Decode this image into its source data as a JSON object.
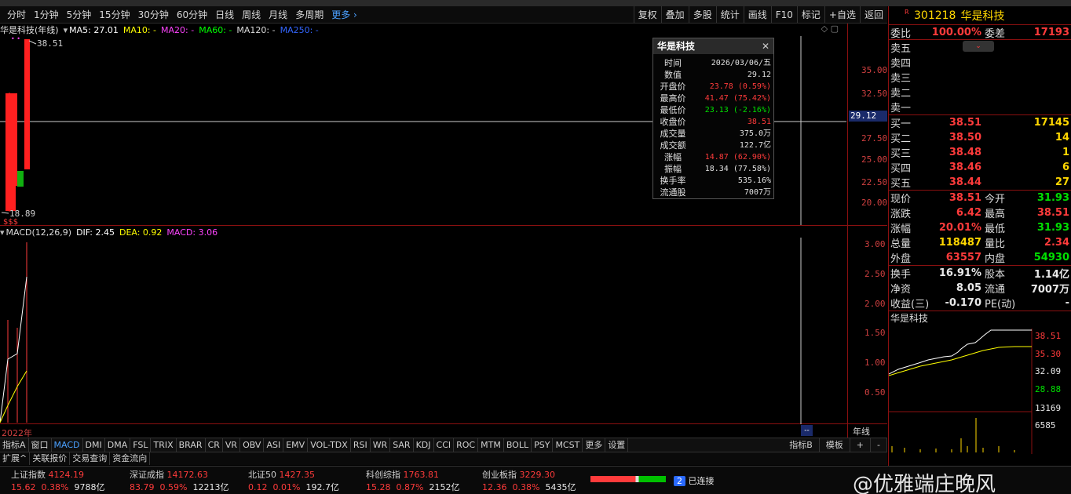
{
  "toolbar": {
    "periods": [
      "分时",
      "1分钟",
      "5分钟",
      "15分钟",
      "30分钟",
      "60分钟",
      "日线",
      "周线",
      "月线",
      "多周期"
    ],
    "more": "更多",
    "right_buttons": [
      "复权",
      "叠加",
      "多股",
      "统计",
      "画线",
      "F10",
      "标记",
      "+自选",
      "返回"
    ]
  },
  "chart": {
    "title": "华是科技(年线)",
    "ma5": "MA5: 27.01",
    "ma10": "MA10: -",
    "ma20": "MA20: -",
    "ma60": "MA60: -",
    "ma120": "MA120: -",
    "ma250": "MA250: -",
    "high_mark": "38.51",
    "low_mark": "18.89",
    "price_ticks": [
      "35.00",
      "32.50",
      "29.12",
      "27.50",
      "25.00",
      "22.50",
      "20.00"
    ],
    "current_price": "29.12",
    "macd_label": "MACD(12,26,9)",
    "dif": "DIF: 2.45",
    "dea": "DEA: 0.92",
    "macd": "MACD: 3.06",
    "macd_ticks": [
      "3.00",
      "2.50",
      "2.00",
      "1.50",
      "1.00",
      "0.50"
    ],
    "x_label": "2022年",
    "period_label": "年线"
  },
  "tooltip": {
    "title": "华是科技",
    "rows": [
      {
        "label": "时间",
        "value": "2026/03/06/五",
        "color": "#e0e0e0"
      },
      {
        "label": "数值",
        "value": "29.12",
        "color": "#e0e0e0"
      },
      {
        "label": "开盘价",
        "value": "23.78 (0.59%)",
        "color": "#ff3b3b"
      },
      {
        "label": "最高价",
        "value": "41.47 (75.42%)",
        "color": "#ff3b3b"
      },
      {
        "label": "最低价",
        "value": "23.13 (-2.16%)",
        "color": "#00e000"
      },
      {
        "label": "收盘价",
        "value": "38.51",
        "color": "#ff3b3b"
      },
      {
        "label": "成交量",
        "value": "375.0万",
        "color": "#e0e0e0"
      },
      {
        "label": "成交额",
        "value": "122.7亿",
        "color": "#e0e0e0"
      },
      {
        "label": "涨幅",
        "value": "14.87 (62.90%)",
        "color": "#ff3b3b"
      },
      {
        "label": "振幅",
        "value": "18.34 (77.58%)",
        "color": "#e0e0e0"
      },
      {
        "label": "换手率",
        "value": "535.16%",
        "color": "#e0e0e0"
      },
      {
        "label": "流通股",
        "value": "7007万",
        "color": "#e0e0e0"
      }
    ]
  },
  "indicator_tabs": [
    "指标A",
    "窗口",
    "MACD",
    "DMI",
    "DMA",
    "FSL",
    "TRIX",
    "BRAR",
    "CR",
    "VR",
    "OBV",
    "ASI",
    "EMV",
    "VOL-TDX",
    "RSI",
    "WR",
    "SAR",
    "KDJ",
    "CCI",
    "ROC",
    "MTM",
    "BOLL",
    "PSY",
    "MCST",
    "更多",
    "设置"
  ],
  "indicator_tabs_right": [
    "指标B",
    "模板",
    "+",
    "-"
  ],
  "sub_tabs": [
    "扩展^",
    "关联报价",
    "交易查询",
    "资金流向"
  ],
  "status": {
    "indices": [
      {
        "name": "上证指数",
        "value": "4124.19",
        "chg": "15.62",
        "pct": "0.38%",
        "amount": "9788亿"
      },
      {
        "name": "深证成指",
        "value": "14172.63",
        "chg": "83.79",
        "pct": "0.59%",
        "amount": "12213亿"
      },
      {
        "name": "北证50",
        "value": "1427.35",
        "chg": "0.12",
        "pct": "0.01%",
        "amount": "192.7亿"
      },
      {
        "name": "科创综指",
        "value": "1763.81",
        "chg": "15.28",
        "pct": "0.87%",
        "amount": "2152亿"
      },
      {
        "name": "创业板指",
        "value": "3229.30",
        "chg": "12.36",
        "pct": "0.38%",
        "amount": "5435亿"
      }
    ],
    "conn_badge": "2",
    "conn_text": "已连接",
    "watermark": "@优雅端庄晚风"
  },
  "quote": {
    "code": "301218",
    "name": "华是科技",
    "ratio_label": "委比",
    "ratio": "100.00%",
    "diff_label": "委差",
    "diff": "17193",
    "sell": [
      "卖五",
      "卖四",
      "卖三",
      "卖二",
      "卖一"
    ],
    "buy": [
      {
        "label": "买一",
        "price": "38.51",
        "vol": "17145"
      },
      {
        "label": "买二",
        "price": "38.50",
        "vol": "14"
      },
      {
        "label": "买三",
        "price": "38.48",
        "vol": "1"
      },
      {
        "label": "买四",
        "price": "38.46",
        "vol": "6"
      },
      {
        "label": "买五",
        "price": "38.44",
        "vol": "27"
      }
    ],
    "stats": [
      {
        "l1": "现价",
        "v1": "38.51",
        "c1": "#ff3b3b",
        "l2": "今开",
        "v2": "31.93",
        "c2": "#00e000"
      },
      {
        "l1": "涨跌",
        "v1": "6.42",
        "c1": "#ff3b3b",
        "l2": "最高",
        "v2": "38.51",
        "c2": "#ff3b3b"
      },
      {
        "l1": "涨幅",
        "v1": "20.01%",
        "c1": "#ff3b3b",
        "l2": "最低",
        "v2": "31.93",
        "c2": "#00e000"
      },
      {
        "l1": "总量",
        "v1": "118487",
        "c1": "#ffd700",
        "l2": "量比",
        "v2": "2.34",
        "c2": "#ff3b3b"
      },
      {
        "l1": "外盘",
        "v1": "63557",
        "c1": "#ff3b3b",
        "l2": "内盘",
        "v2": "54930",
        "c2": "#00e000"
      }
    ],
    "stats2": [
      {
        "l1": "换手",
        "v1": "16.91%",
        "l2": "股本",
        "v2": "1.14亿"
      },
      {
        "l1": "净资",
        "v1": "8.05",
        "l2": "流通",
        "v2": "7007万"
      },
      {
        "l1": "收益(三)",
        "v1": "-0.170",
        "l2": "PE(动)",
        "v2": "-"
      }
    ],
    "mini_title": "华是科技",
    "mini_ticks": [
      "38.51",
      "35.30",
      "32.09",
      "28.88",
      "13169",
      "6585"
    ]
  }
}
